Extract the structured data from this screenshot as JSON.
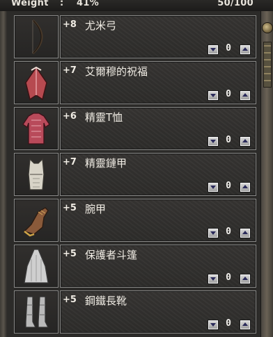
{
  "header": {
    "weight_label": "Weight",
    "separator": ":",
    "weight_percent": "41%",
    "capacity": "50/100"
  },
  "items": [
    {
      "enchant": "+8",
      "name": "尤米弓",
      "quantity": "0",
      "icon": "bow-icon"
    },
    {
      "enchant": "+7",
      "name": "艾爾穆的祝福",
      "quantity": "0",
      "icon": "cloak-icon"
    },
    {
      "enchant": "+6",
      "name": "精靈T恤",
      "quantity": "0",
      "icon": "tshirt-icon"
    },
    {
      "enchant": "+7",
      "name": "精靈鏈甲",
      "quantity": "0",
      "icon": "chainmail-icon"
    },
    {
      "enchant": "+5",
      "name": "腕甲",
      "quantity": "0",
      "icon": "bracer-icon"
    },
    {
      "enchant": "+5",
      "name": "保護者斗篷",
      "quantity": "0",
      "icon": "protector-cloak-icon"
    },
    {
      "enchant": "+5",
      "name": "鋼鐵長靴",
      "quantity": "0",
      "icon": "boots-icon"
    }
  ]
}
